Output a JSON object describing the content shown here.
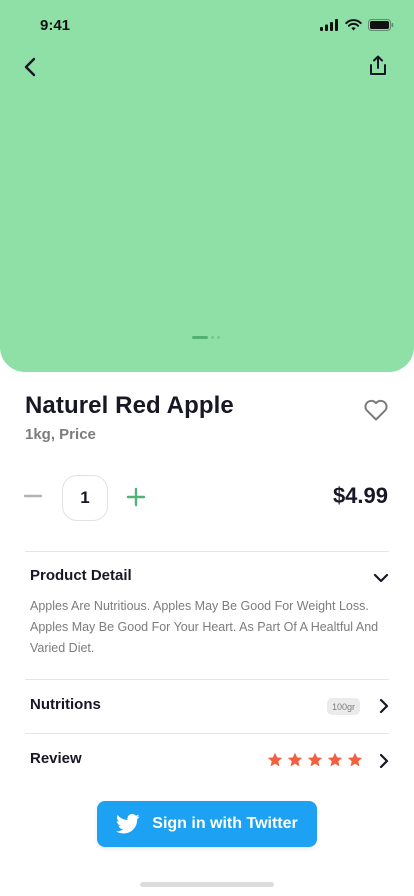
{
  "status_bar": {
    "time": "9:41"
  },
  "product": {
    "name": "Naturel Red Apple",
    "unit": "1kg, Price",
    "quantity": "1",
    "price": "$4.99"
  },
  "detail": {
    "label": "Product Detail",
    "description": "Apples Are Nutritious. Apples May Be Good For Weight Loss. Apples May Be Good For Your Heart. As Part Of A Healtful And Varied Diet."
  },
  "nutritions": {
    "label": "Nutritions",
    "badge": "100gr"
  },
  "review": {
    "label": "Review",
    "rating": 5,
    "max_rating": 5
  },
  "twitter_button": {
    "label": "Sign in with Twitter"
  },
  "colors": {
    "hero_bg": "#8fe0a7",
    "accent_green": "#53b175",
    "star": "#f3603f",
    "twitter": "#1da1f2"
  },
  "icons": [
    "back-icon",
    "share-icon",
    "heart-icon",
    "minus-icon",
    "plus-icon",
    "chevron-down-icon",
    "chevron-right-icon",
    "star-icon",
    "twitter-icon"
  ]
}
